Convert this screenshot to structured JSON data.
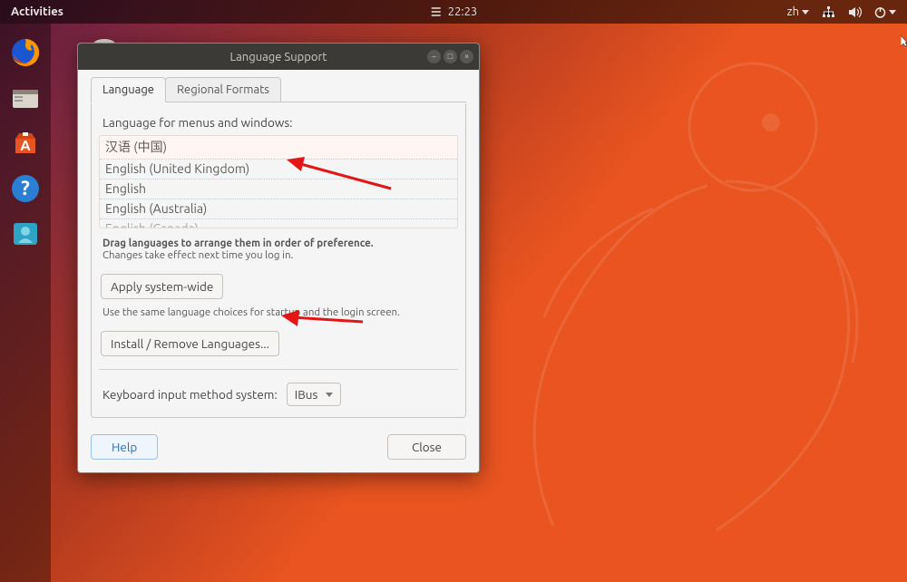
{
  "topbar": {
    "activities": "Activities",
    "time": "22:23",
    "input": "zh"
  },
  "dock": {
    "items": [
      {
        "name": "firefox"
      },
      {
        "name": "files"
      },
      {
        "name": "software"
      },
      {
        "name": "help"
      },
      {
        "name": "contacts"
      }
    ]
  },
  "dialog": {
    "title": "Language Support",
    "tabs": {
      "language": "Language",
      "regional": "Regional Formats"
    },
    "lang_section_label": "Language for menus and windows:",
    "languages": [
      "汉语 (中国)",
      "English (United Kingdom)",
      "English",
      "English (Australia)",
      "English (Canada)"
    ],
    "drag_hint_bold": "Drag languages to arrange them in order of preference.",
    "drag_hint_sub": "Changes take effect next time you log in.",
    "apply_button": "Apply system-wide",
    "apply_hint": "Use the same language choices for startup and the login screen.",
    "install_button": "Install / Remove Languages...",
    "keyboard_label": "Keyboard input method system:",
    "keyboard_value": "IBus",
    "help": "Help",
    "close": "Close"
  }
}
